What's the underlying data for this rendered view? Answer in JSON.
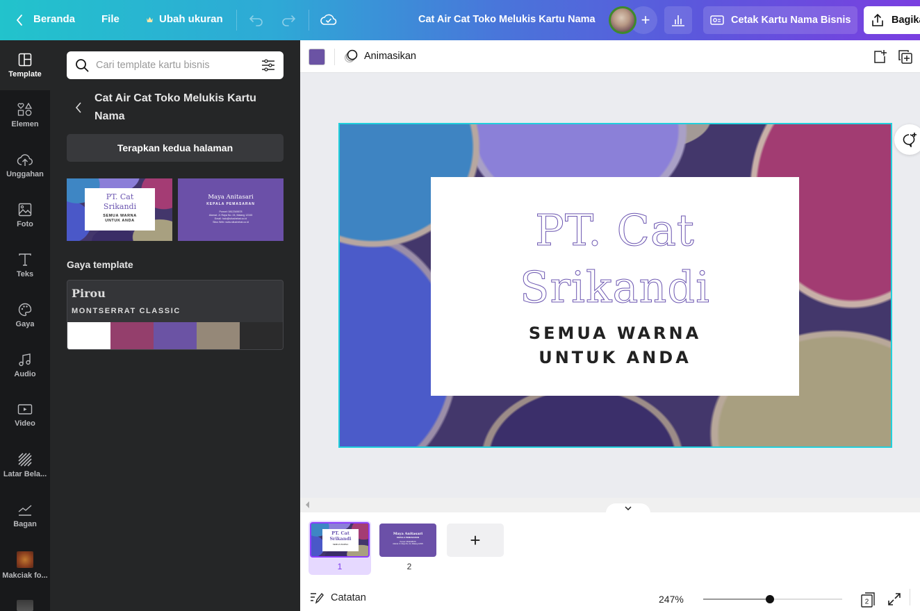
{
  "topbar": {
    "home_label": "Beranda",
    "file_label": "File",
    "resize_label": "Ubah ukuran",
    "design_title": "Cat Air Cat Toko Melukis Kartu Nama",
    "add_collaborator": "+",
    "print_label": "Cetak Kartu Nama Bisnis",
    "share_label": "Bagikan"
  },
  "rail": {
    "items": [
      {
        "label": "Template",
        "icon": "template-icon",
        "active": true
      },
      {
        "label": "Elemen",
        "icon": "elements-icon"
      },
      {
        "label": "Unggahan",
        "icon": "upload-icon"
      },
      {
        "label": "Foto",
        "icon": "photo-icon"
      },
      {
        "label": "Teks",
        "icon": "text-icon"
      },
      {
        "label": "Gaya",
        "icon": "palette-icon"
      },
      {
        "label": "Audio",
        "icon": "music-note-icon"
      },
      {
        "label": "Video",
        "icon": "video-icon"
      },
      {
        "label": "Latar Bela...",
        "icon": "background-icon"
      },
      {
        "label": "Bagan",
        "icon": "chart-icon"
      },
      {
        "label": "Makciak fo...",
        "icon": "folder-thumbnail"
      }
    ]
  },
  "panel": {
    "search_placeholder": "Cari template kartu bisnis",
    "template_title": "Cat Air Cat Toko Melukis Kartu Nama",
    "apply_button": "Terapkan kedua halaman",
    "thumb_front": {
      "name_line1": "PT. Cat",
      "name_line2": "Srikandi",
      "tagline1": "SEMUA WARNA",
      "tagline2": "UNTUK ANDA"
    },
    "thumb_back": {
      "person": "Maya Anitasari",
      "role": "KEPALA PEMASARAN",
      "line1": "Ponsel: 0812345678",
      "line2": "Alamat: Jl. Raya No. 24, Malang 12345",
      "line3": "Email: halo@situshebat.co.id",
      "line4": "Situs Web: www.situshebat.co.id"
    },
    "style_heading": "Gaya template",
    "style": {
      "font_primary": "Pirou",
      "font_secondary": "MONTSERRAT CLASSIC",
      "colors": [
        "#ffffff",
        "#943f6c",
        "#6b53a4",
        "#958878",
        "#2b2b2c"
      ]
    }
  },
  "editor": {
    "selected_color": "#6b53a4",
    "animate_label": "Animasikan",
    "design": {
      "title_line1": "PT. Cat",
      "title_line2": "Srikandi",
      "tagline_line1": "SEMUA WARNA",
      "tagline_line2": "UNTUK ANDA"
    }
  },
  "pages": {
    "items": [
      {
        "number": "1",
        "active": true
      },
      {
        "number": "2",
        "active": false
      }
    ],
    "add_label": "+"
  },
  "footer": {
    "notes_label": "Catatan",
    "zoom_value": "247%",
    "zoom_fraction": 0.48,
    "page_count": "2"
  }
}
